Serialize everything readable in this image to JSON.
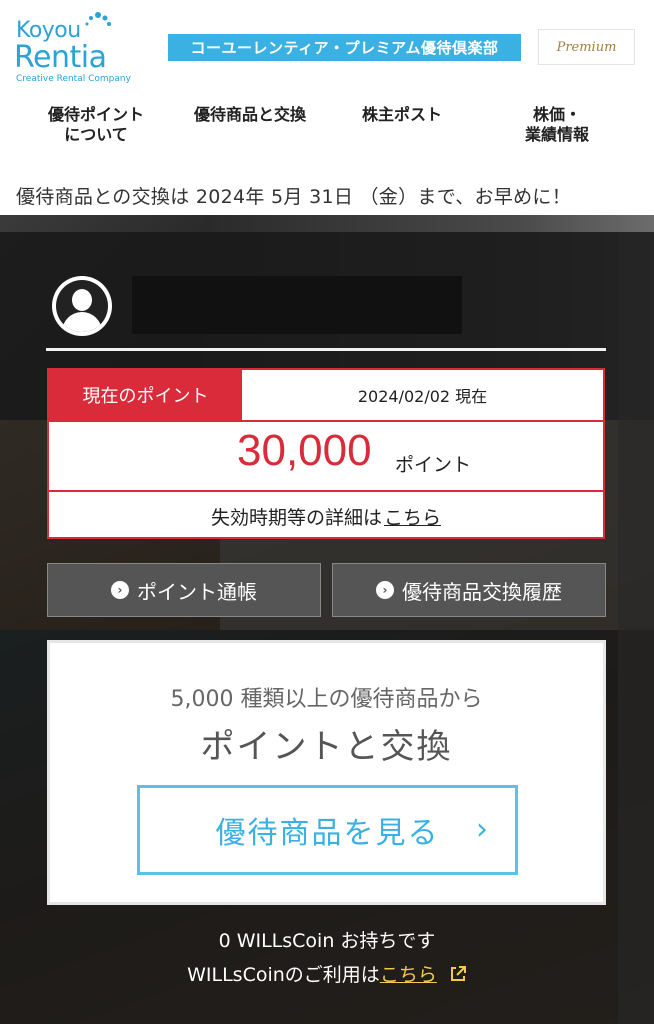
{
  "header": {
    "logo_top": "Koyou",
    "logo_main": "Rentia",
    "logo_tagline": "Creative Rental Company",
    "club_banner": "コーユーレンティア・プレミアム優待倶楽部",
    "premium_badge": "Premium",
    "accent_color": "#3bb0e3"
  },
  "nav": {
    "items": [
      {
        "label": "優待ポイント\nについて"
      },
      {
        "label": "優待商品と交換"
      },
      {
        "label": "株主ポスト"
      },
      {
        "label": "株価・\n業績情報"
      }
    ]
  },
  "notice": "優待商品との交換は 2024年 5月 31日 （金）まで、お早めに！",
  "points": {
    "label": "現在のポイント",
    "as_of": "2024/02/02 現在",
    "value": "30,000",
    "unit": "ポイント",
    "expire_text": "失効時期等の詳細は",
    "expire_link": "こちら",
    "accent_color": "#d92b3a"
  },
  "buttons": {
    "ledger": "ポイント通帳",
    "history": "優待商品交換履歴"
  },
  "exchange": {
    "line1": "5,000 種類以上の優待商品から",
    "line2": "ポイントと交換",
    "view_button": "優待商品を見る",
    "chevron": "›"
  },
  "coin": {
    "balance": "0 WILLsCoin お持ちです",
    "usage_text": "WILLsCoinのご利用は",
    "usage_link": "こちら"
  }
}
